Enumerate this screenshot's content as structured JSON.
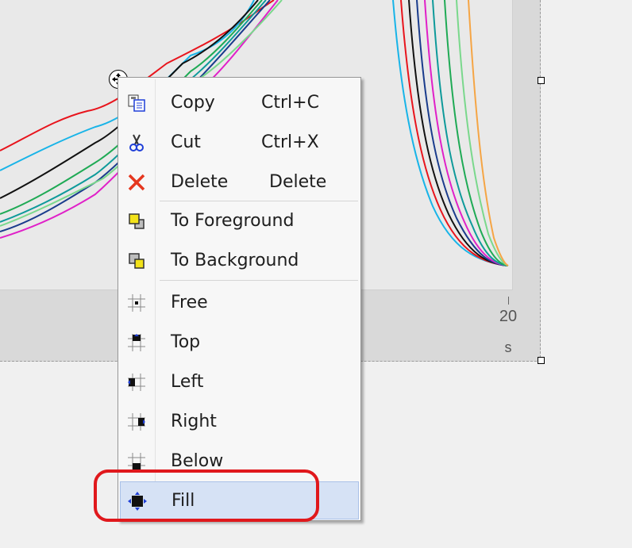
{
  "chart": {
    "x_tick_label": "20",
    "x_unit_label": "s"
  },
  "context_menu": {
    "items": [
      {
        "label": "Copy",
        "shortcut": "Ctrl+C",
        "icon": "copy-icon"
      },
      {
        "label": "Cut",
        "shortcut": "Ctrl+X",
        "icon": "scissors-icon"
      },
      {
        "label": "Delete",
        "shortcut": "Delete",
        "icon": "delete-x-icon"
      },
      {
        "label": "To Foreground",
        "icon": "bring-to-front-icon"
      },
      {
        "label": "To Background",
        "icon": "send-to-back-icon"
      },
      {
        "label": "Free",
        "icon": "dock-free-icon"
      },
      {
        "label": "Top",
        "icon": "dock-top-icon"
      },
      {
        "label": "Left",
        "icon": "dock-left-icon"
      },
      {
        "label": "Right",
        "icon": "dock-right-icon"
      },
      {
        "label": "Below",
        "icon": "dock-bottom-icon"
      },
      {
        "label": "Fill",
        "icon": "dock-fill-icon",
        "selected": true
      }
    ]
  },
  "colors": {
    "menu_selected_bg": "#d6e2f5",
    "annotation_red": "#e0181c",
    "icon_blue": "#1f3fd8",
    "icon_yellow": "#f2e21a"
  }
}
